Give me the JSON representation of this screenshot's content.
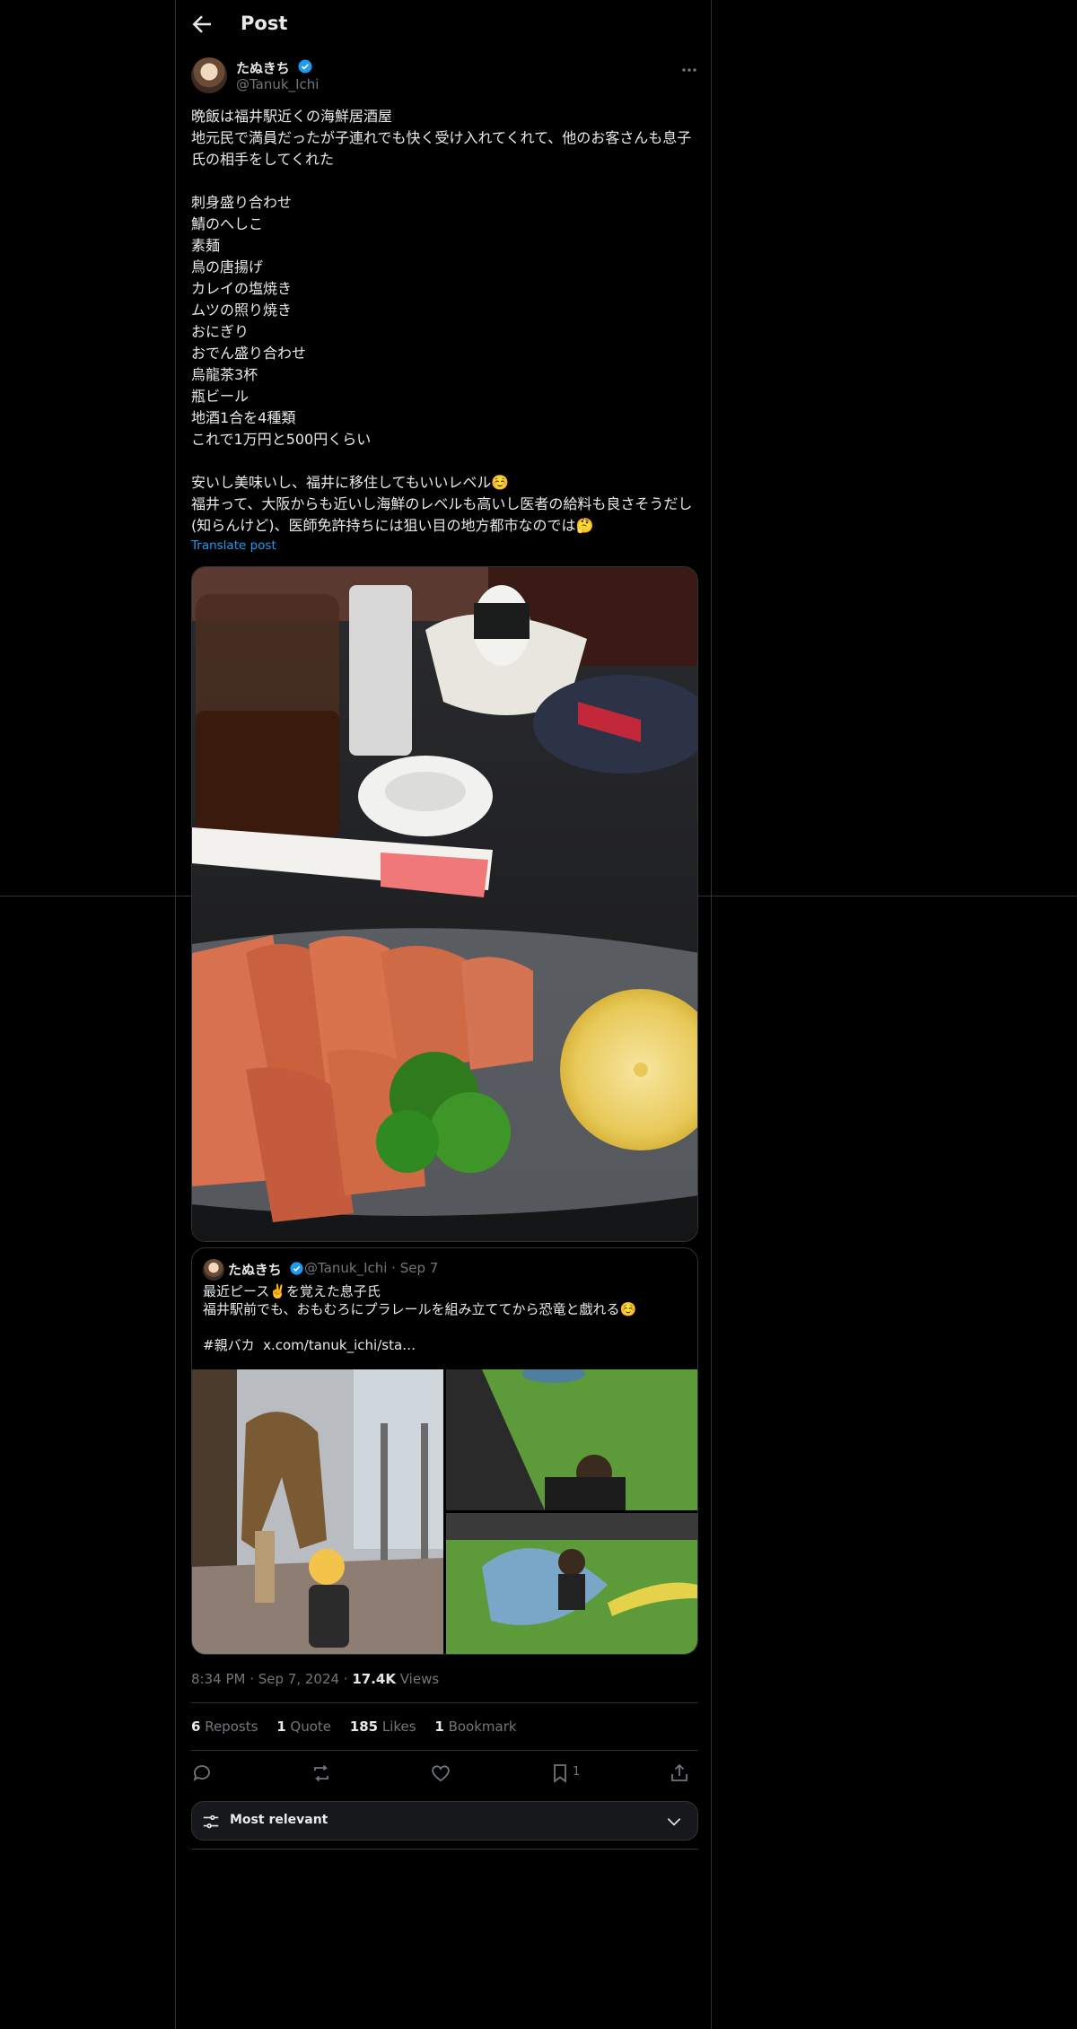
{
  "header": {
    "title": "Post"
  },
  "author": {
    "name": "たぬきち",
    "handle": "@Tanuk_Ichi"
  },
  "post": {
    "text": "晩飯は福井駅近くの海鮮居酒屋\n地元民で満員だったが子連れでも快く受け入れてくれて、他のお客さんも息子氏の相手をしてくれた\n\n刺身盛り合わせ\n鯖のへしこ\n素麺\n鳥の唐揚げ\nカレイの塩焼き\nムツの照り焼き\nおにぎり\nおでん盛り合わせ\n烏龍茶3杯\n瓶ビール\n地酒1合を4種類\nこれで1万円と500円くらい\n\n安いし美味いし、福井に移住してもいいレベル☺️\n福井って、大阪からも近いし海鮮のレベルも高いし医者の給料も良さそうだし(知らんけど)、医師免許持ちには狙い目の地方都市なのでは🤔",
    "translate": "Translate post"
  },
  "quote": {
    "name": "たぬきち",
    "meta": "@Tanuk_Ichi · Sep 7",
    "text": "最近ピース✌️を覚えた息子氏\n福井駅前でも、おもむろにプラレールを組み立ててから恐竜と戯れる☺️\n\n#親バカ  x.com/tanuk_ichi/sta…"
  },
  "timestamp": {
    "time": "8:34 PM · Sep 7, 2024 · ",
    "views_count": "17.4K",
    "views_label": " Views"
  },
  "stats": {
    "reposts_count": "6",
    "reposts_label": " Reposts",
    "quotes_count": "1",
    "quotes_label": " Quote",
    "likes_count": "185",
    "likes_label": " Likes",
    "bookmarks_count": "1",
    "bookmarks_label": " Bookmark"
  },
  "actions": {
    "bookmark_count": "1"
  },
  "sort": {
    "label": "Most relevant"
  },
  "colors": {
    "background": "#000000",
    "text": "#e7e9ea",
    "muted": "#71767b",
    "accent": "#1d9bf0",
    "border": "#2f3336"
  },
  "icons": [
    "back-arrow-icon",
    "verified-badge-icon",
    "more-icon",
    "reply-icon",
    "repost-icon",
    "like-icon",
    "bookmark-icon",
    "share-icon",
    "filter-icon",
    "chevron-down-icon"
  ]
}
